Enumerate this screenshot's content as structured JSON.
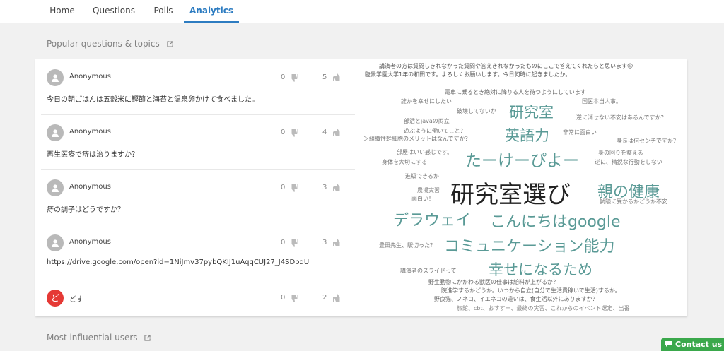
{
  "nav": {
    "tabs": [
      {
        "label": "Home"
      },
      {
        "label": "Questions"
      },
      {
        "label": "Polls"
      },
      {
        "label": "Analytics"
      }
    ],
    "active_tab": "Analytics",
    "accent_color": "#2d7cc1"
  },
  "popular": {
    "title": "Popular questions & topics",
    "questions": [
      {
        "author": "Anonymous",
        "text": "今日の朝ごはんは五穀米に鰹節と海苔と温泉卵かけて食べました。",
        "downvotes": "0",
        "upvotes": "5"
      },
      {
        "author": "Anonymous",
        "text": "再生医療で痔は治りますか？",
        "downvotes": "0",
        "upvotes": "4"
      },
      {
        "author": "Anonymous",
        "text": "痔の調子はどうですか？",
        "downvotes": "0",
        "upvotes": "3"
      },
      {
        "author": "Anonymous",
        "text": "https://drive.google.com/open?id=1NiJmv37pybQKIJ1uAqqCUJ27_J4SDpdU",
        "downvotes": "0",
        "upvotes": "3"
      },
      {
        "author": "どす",
        "avatar_letter": "ど",
        "avatar_color": "#e53935",
        "text": "",
        "downvotes": "0",
        "upvotes": "2"
      }
    ],
    "word_cloud": {
      "words": [
        {
          "text": "講演者の方は質問しきれなかった質問や答えきれなかったものにここで答えてくれたらと思います😩",
          "weight": 1
        },
        {
          "text": "臨景学園大学1年の和田です。よろしくお願いします。今日何時に起きましたか。",
          "weight": 1
        },
        {
          "text": "電車に乗るとき絶対に降りる人を待つようにしています",
          "weight": 1
        },
        {
          "text": "誰かを幸せにしたい",
          "weight": 1
        },
        {
          "text": "国医本当人事。",
          "weight": 1
        },
        {
          "text": "破壊してないか",
          "weight": 1
        },
        {
          "text": "研究室",
          "weight": 4
        },
        {
          "text": "逆に消せない不安はあるんですか？",
          "weight": 1
        },
        {
          "text": "部活とjavaの両立",
          "weight": 1
        },
        {
          "text": "遊ぶように働いてこと？",
          "weight": 1
        },
        {
          "text": "英語力",
          "weight": 4
        },
        {
          "text": "非常に面白い",
          "weight": 1
        },
        {
          "text": "＞組織性幹細胞のメリットはなんですか？",
          "weight": 1
        },
        {
          "text": "身長は何センチですか？",
          "weight": 1
        },
        {
          "text": "部屋はいい感じです。",
          "weight": 1
        },
        {
          "text": "たーけーぴよー",
          "weight": 5
        },
        {
          "text": "身の回りを整える",
          "weight": 1
        },
        {
          "text": "身体を大切にする",
          "weight": 1
        },
        {
          "text": "逆に、精鋭な行動をしない",
          "weight": 1
        },
        {
          "text": "進級できるか",
          "weight": 1
        },
        {
          "text": "研究室選び",
          "weight": 7
        },
        {
          "text": "親の健康",
          "weight": 5
        },
        {
          "text": "農場実習",
          "weight": 1
        },
        {
          "text": "面白い！",
          "weight": 1
        },
        {
          "text": "試験に受かるかどうか不安",
          "weight": 1
        },
        {
          "text": "デラウェイ",
          "weight": 5
        },
        {
          "text": "こんにちはgoogle",
          "weight": 5
        },
        {
          "text": "豊田先生、駅切った？",
          "weight": 1
        },
        {
          "text": "コミュニケーション能力",
          "weight": 5
        },
        {
          "text": "講演者のスライドって",
          "weight": 1
        },
        {
          "text": "幸せになるため",
          "weight": 5
        },
        {
          "text": "野生動物にかかわる獣医の仕事は給料が上がるか？",
          "weight": 1
        },
        {
          "text": "院進学するかどうか。いつから自立(自分で生活費稼いで生活)するか。",
          "weight": 1
        },
        {
          "text": "野良猫、ノネコ、イエネコの違いは、食生活以外にありますか？",
          "weight": 1
        },
        {
          "text": "旅館、cbt、おすすー、最終の実習、これからのイベント選定、出番",
          "weight": 1
        }
      ]
    }
  },
  "influential": {
    "title": "Most influential users"
  },
  "contact": {
    "label": "Contact us",
    "color": "#3aa84b"
  }
}
